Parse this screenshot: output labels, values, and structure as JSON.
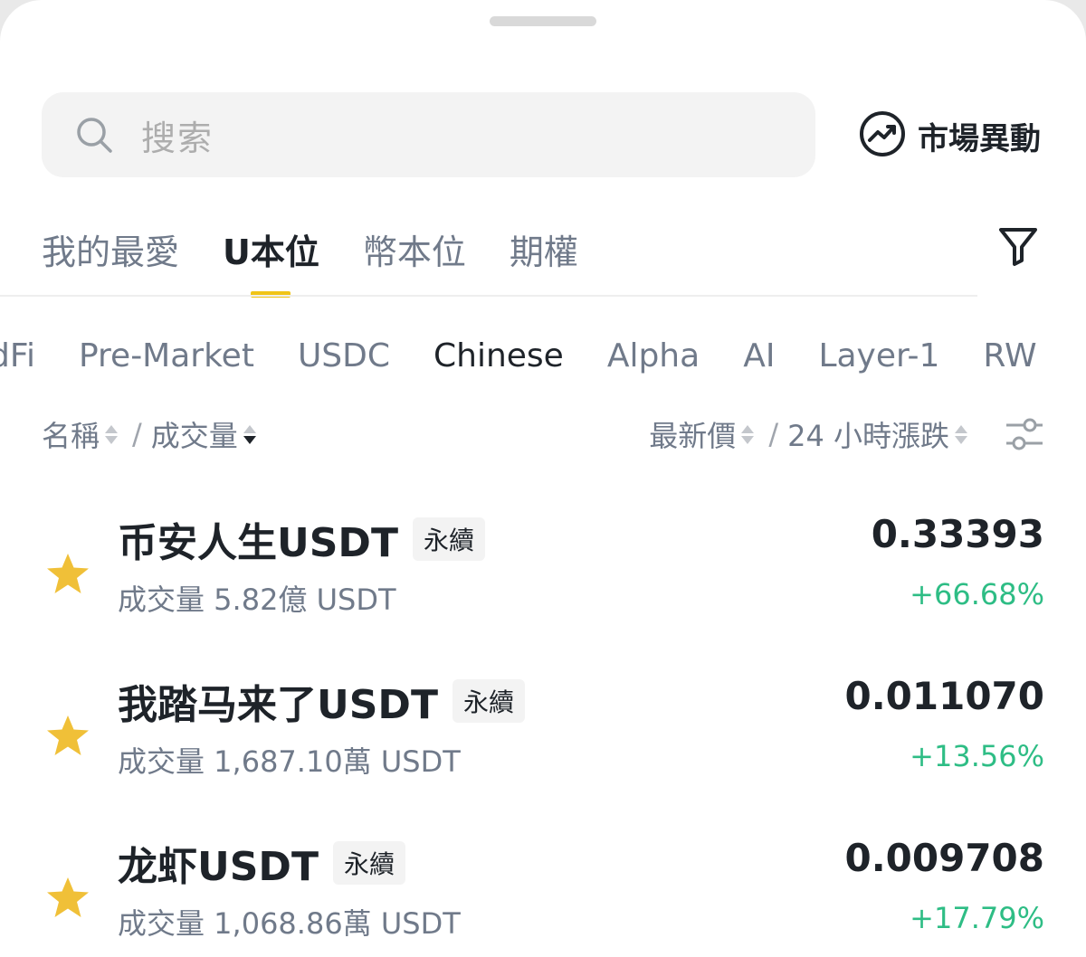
{
  "search": {
    "placeholder": "搜索"
  },
  "market_move": {
    "label": "市場異動"
  },
  "tabs": [
    {
      "label": "我的最愛",
      "active": false
    },
    {
      "label": "U本位",
      "active": true
    },
    {
      "label": "幣本位",
      "active": false
    },
    {
      "label": "期權",
      "active": false
    }
  ],
  "chips": [
    {
      "label": "dFi",
      "active": false
    },
    {
      "label": "Pre-Market",
      "active": false
    },
    {
      "label": "USDC",
      "active": false
    },
    {
      "label": "Chinese",
      "active": true
    },
    {
      "label": "Alpha",
      "active": false
    },
    {
      "label": "AI",
      "active": false
    },
    {
      "label": "Layer-1",
      "active": false
    },
    {
      "label": "RW",
      "active": false
    }
  ],
  "columns": {
    "name": "名稱",
    "sep": "/",
    "volume": "成交量",
    "price": "最新價",
    "change": "24 小時漲跌"
  },
  "rows": [
    {
      "name": "币安人生USDT",
      "badge": "永續",
      "volume": "成交量 5.82億 USDT",
      "price": "0.33393",
      "change": "+66.68%",
      "favorite": true
    },
    {
      "name": "我踏马来了USDT",
      "badge": "永續",
      "volume": "成交量 1,687.10萬 USDT",
      "price": "0.011070",
      "change": "+13.56%",
      "favorite": true
    },
    {
      "name": "龙虾USDT",
      "badge": "永續",
      "volume": "成交量 1,068.86萬 USDT",
      "price": "0.009708",
      "change": "+17.79%",
      "favorite": true
    }
  ],
  "colors": {
    "accent": "#f0c417",
    "up": "#2ebd85",
    "star": "#f0c038"
  },
  "icons": [
    "search-icon",
    "trend-up-icon",
    "filter-icon",
    "settings-sliders-icon",
    "star-icon"
  ]
}
